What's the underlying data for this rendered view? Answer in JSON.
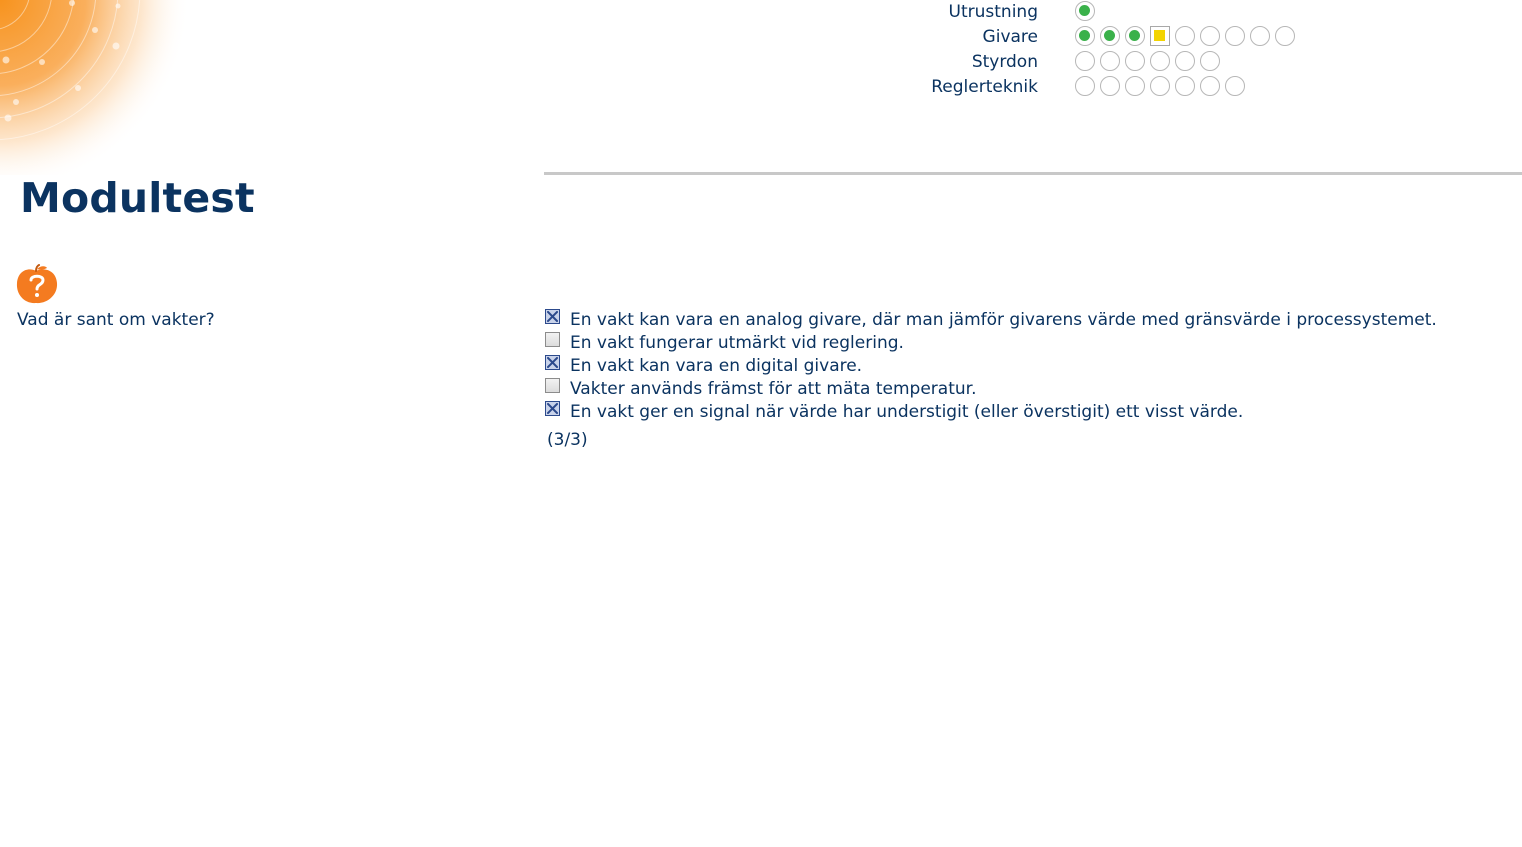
{
  "page": {
    "title": "Modultest"
  },
  "progress": {
    "rows": [
      {
        "label": "Utrustning",
        "states": [
          "done"
        ]
      },
      {
        "label": "Givare",
        "states": [
          "done",
          "done",
          "done",
          "current",
          "todo",
          "todo",
          "todo",
          "todo",
          "todo"
        ]
      },
      {
        "label": "Styrdon",
        "states": [
          "todo",
          "todo",
          "todo",
          "todo",
          "todo",
          "todo"
        ]
      },
      {
        "label": "Reglerteknik",
        "states": [
          "todo",
          "todo",
          "todo",
          "todo",
          "todo",
          "todo",
          "todo"
        ]
      }
    ],
    "colors": {
      "done": "#3ab14a",
      "current": "#f3d400",
      "todo_border": "#b7b7b7"
    }
  },
  "question": {
    "icon": "question-apple-icon",
    "text": "Vad är sant om vakter?",
    "answers": [
      {
        "text": "En vakt kan vara en analog givare, där man jämför givarens värde med gränsvärde i processystemet.",
        "checked": true
      },
      {
        "text": "En vakt fungerar utmärkt vid reglering.",
        "checked": false
      },
      {
        "text": "En vakt kan vara en digital givare.",
        "checked": true
      },
      {
        "text": "Vakter används främst för att mäta temperatur.",
        "checked": false
      },
      {
        "text": "En vakt ger en signal när värde har understigit (eller överstigit) ett visst värde.",
        "checked": true
      }
    ],
    "score": "(3/3)"
  },
  "theme": {
    "text_color": "#0b3360",
    "accent_orange": "#f47b20"
  }
}
